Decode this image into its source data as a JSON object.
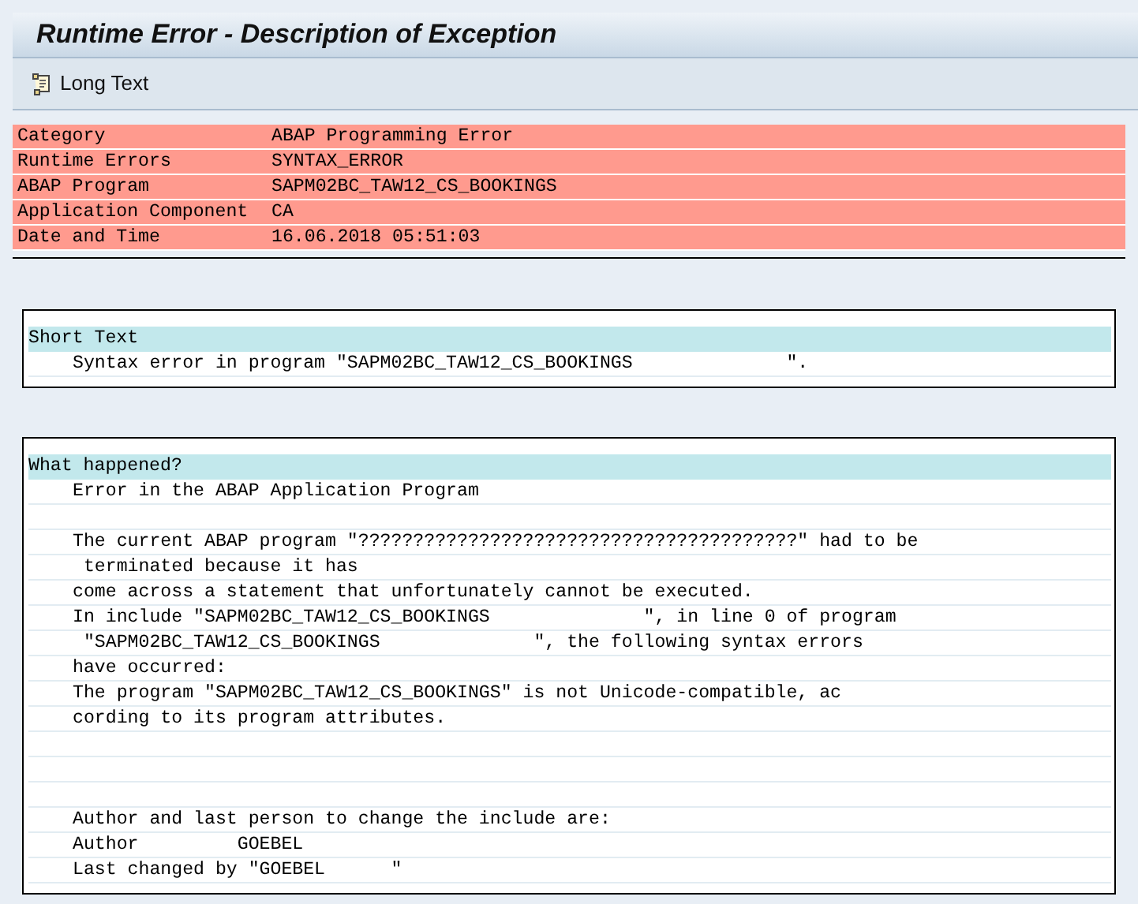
{
  "window": {
    "title": "Runtime Error - Description of Exception"
  },
  "toolbar": {
    "buttons": [
      {
        "label": "Long Text"
      }
    ]
  },
  "header_fields": [
    {
      "label": "Category",
      "value": "ABAP Programming Error"
    },
    {
      "label": "Runtime Errors",
      "value": "SYNTAX_ERROR"
    },
    {
      "label": "ABAP Program",
      "value": "SAPM02BC_TAW12_CS_BOOKINGS"
    },
    {
      "label": "Application Component",
      "value": "CA"
    },
    {
      "label": "Date and Time",
      "value": "16.06.2018 05:51:03"
    }
  ],
  "sections": [
    {
      "heading": "Short Text",
      "lines": [
        {
          "kind": "text",
          "text": "Syntax error in program \"SAPM02BC_TAW12_CS_BOOKINGS              \"."
        }
      ]
    },
    {
      "heading": "What happened?",
      "lines": [
        {
          "kind": "text",
          "text": "Error in the ABAP Application Program"
        },
        {
          "kind": "blank"
        },
        {
          "kind": "text",
          "text": "The current ABAP program \"????????????????????????????????????????\" had to be"
        },
        {
          "kind": "text",
          "text": " terminated because it has"
        },
        {
          "kind": "text",
          "text": "come across a statement that unfortunately cannot be executed."
        },
        {
          "kind": "text",
          "text": "In include \"SAPM02BC_TAW12_CS_BOOKINGS              \", in line 0 of program"
        },
        {
          "kind": "text",
          "text": " \"SAPM02BC_TAW12_CS_BOOKINGS              \", the following syntax errors"
        },
        {
          "kind": "text",
          "text": "have occurred:"
        },
        {
          "kind": "text",
          "text": "The program \"SAPM02BC_TAW12_CS_BOOKINGS\" is not Unicode-compatible, ac"
        },
        {
          "kind": "text",
          "text": "cording to its program attributes."
        },
        {
          "kind": "blank"
        },
        {
          "kind": "blank"
        },
        {
          "kind": "blank"
        },
        {
          "kind": "text",
          "text": "Author and last person to change the include are:"
        },
        {
          "kind": "text",
          "text": "Author         GOEBEL"
        },
        {
          "kind": "text",
          "text": "Last changed by \"GOEBEL      \""
        }
      ]
    }
  ]
}
